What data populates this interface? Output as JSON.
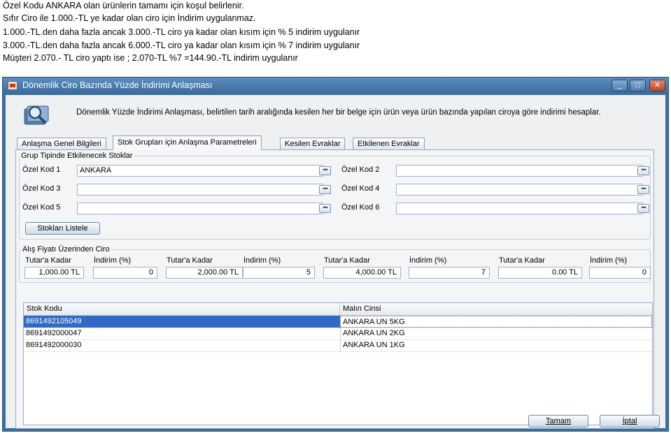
{
  "document_lines": [
    "Özel Kodu ANKARA olan ürünlerin tamamı için koşul belirlenir.",
    "Sıfır Ciro ile 1.000.-TL ye kadar olan ciro için İndirim uygulanmaz.",
    "1.000.-TL.den daha fazla ancak 3.000.-TL ciro ya kadar olan kısım için % 5 indirim uygulanır",
    "3.000.-TL.den daha fazla ancak 6.000.-TL ciro ya kadar olan kısım için % 7 indirim uygulanır",
    "Müşteri 2.070.- TL  ciro yaptı ise ;  2.070-TL %7 =144.90.-TL indirim uygulanır"
  ],
  "window": {
    "title": "Dönemlik Ciro Bazında Yüzde İndirimi Anlaşması",
    "controls": [
      "_",
      "□",
      "✕"
    ]
  },
  "header": {
    "description": "Dönemlik Yüzde İndirimi Anlaşması, belirtilen tarih aralığında kesilen her bir belge için ürün veya ürün bazında yapılan ciroya göre indirimi hesaplar."
  },
  "tabs": [
    {
      "label": "Anlaşma Genel Bilgileri",
      "active": false
    },
    {
      "label": "Stok Grupları için Anlaşma Parametreleri",
      "active": true
    },
    {
      "label": "Kesilen Evraklar",
      "active": false
    },
    {
      "label": "Etkilenen Evraklar",
      "active": false
    }
  ],
  "stock_group": {
    "title": "Grup Tipinde Etkilenecek Stoklar",
    "fields": [
      {
        "label": "Özel Kod 1",
        "value": "ANKARA"
      },
      {
        "label": "Özel Kod 2",
        "value": ""
      },
      {
        "label": "Özel Kod 3",
        "value": ""
      },
      {
        "label": "Özel Kod 4",
        "value": ""
      },
      {
        "label": "Özel Kod 5",
        "value": ""
      },
      {
        "label": "Özel Kod 6",
        "value": ""
      }
    ],
    "ellipsis": "•••",
    "list_button": "Stokları Listele"
  },
  "ciro": {
    "title": "Alış Fiyatı Üzerinden Ciro",
    "columns": [
      {
        "label_amount": "Tutar'a Kadar",
        "amount": "1,000.00 TL",
        "label_discount": "İndirim (%)",
        "discount": "0"
      },
      {
        "label_amount": "Tutar'a Kadar",
        "amount": "2,000.00 TL",
        "label_discount": "İndirim (%)",
        "discount": "5"
      },
      {
        "label_amount": "Tutar'a Kadar",
        "amount": "4,000.00 TL",
        "label_discount": "İndirim (%)",
        "discount": "7"
      },
      {
        "label_amount": "Tutar'a Kadar",
        "amount": "0.00 TL",
        "label_discount": "İndirim (%)",
        "discount": "0"
      }
    ]
  },
  "grid": {
    "headers": [
      "Stok Kodu",
      "Malın Cinsi"
    ],
    "rows": [
      {
        "code": "8691492105049",
        "name": "ANKARA UN 5KG",
        "selected": true
      },
      {
        "code": "8691492000047",
        "name": "ANKARA UN 2KG",
        "selected": false
      },
      {
        "code": "8691492000030",
        "name": "ANKARA UN 1KG",
        "selected": false
      }
    ]
  },
  "footer": {
    "ok_label": "Tamam",
    "cancel_label": "İptal"
  },
  "colors": {
    "titlebar": "#3d6f9f",
    "selection": "#316ac5"
  }
}
